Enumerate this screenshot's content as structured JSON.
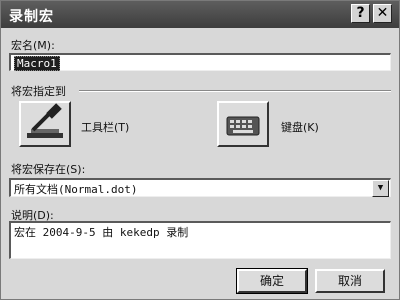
{
  "window": {
    "title": "录制宏",
    "help_label": "?",
    "close_label": "✕"
  },
  "macro_name": {
    "label": "宏名(M):",
    "value": "Macro1"
  },
  "assign": {
    "label": "将宏指定到",
    "toolbar_label": "工具栏(T)",
    "keyboard_label": "键盘(K)"
  },
  "store": {
    "label": "将宏保存在(S):",
    "selected": "所有文档(Normal.dot)",
    "arrow": "▼"
  },
  "description": {
    "label": "说明(D):",
    "value": "宏在 2004-9-5 由 kekedp 录制"
  },
  "buttons": {
    "ok_label": "确定",
    "cancel_label": "取消"
  }
}
